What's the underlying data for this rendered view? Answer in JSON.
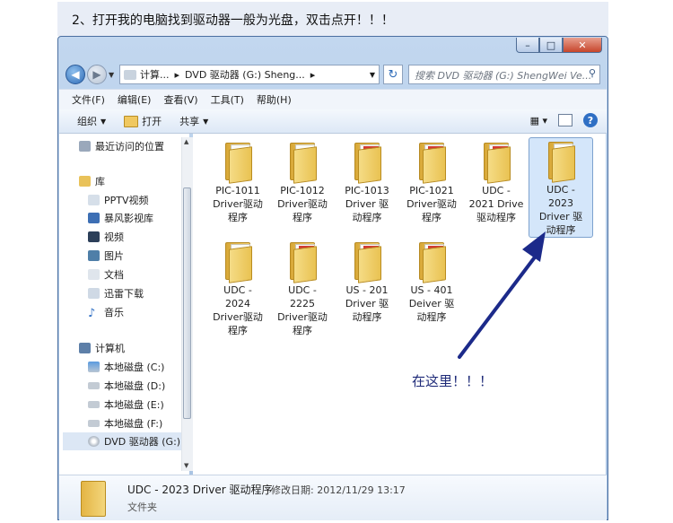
{
  "banner": {
    "text": "2、打开我的电脑找到驱动器一般为光盘，双击点开！！！"
  },
  "window": {
    "buttons": {
      "minimize": "–",
      "maximize": "□",
      "close": "✕"
    }
  },
  "address": {
    "segments": [
      "计算...",
      "▸",
      "DVD 驱动器 (G:) Sheng...",
      "▸"
    ],
    "search_placeholder": "搜索 DVD 驱动器 (G:) ShengWei Ve..."
  },
  "menu": [
    "文件(F)",
    "编辑(E)",
    "查看(V)",
    "工具(T)",
    "帮助(H)"
  ],
  "toolbar": {
    "organize": "组织",
    "open": "打开",
    "share": "共享"
  },
  "nav": {
    "recent": "最近访问的位置",
    "libraries": "库",
    "lib_items": [
      "PPTV视频",
      "暴风影视库",
      "视频",
      "图片",
      "文档",
      "迅雷下载",
      "音乐"
    ],
    "computer": "计算机",
    "drives": [
      "本地磁盘 (C:)",
      "本地磁盘 (D:)",
      "本地磁盘 (E:)",
      "本地磁盘 (F:)",
      "DVD 驱动器 (G:)"
    ]
  },
  "files": [
    {
      "l1": "PIC-1011",
      "l2": "Driver驱动",
      "l3": "程序"
    },
    {
      "l1": "PIC-1012",
      "l2": "Driver驱动",
      "l3": "程序"
    },
    {
      "l1": "PIC-1013",
      "l2": "Driver 驱",
      "l3": "动程序"
    },
    {
      "l1": "PIC-1021",
      "l2": "Driver驱动",
      "l3": "程序"
    },
    {
      "l1": "UDC -",
      "l2": "2021 Drive",
      "l3": "驱动程序"
    },
    {
      "l1": "UDC -",
      "l2": "2023",
      "l3": "Driver 驱",
      "l4": "动程序"
    },
    {
      "l1": "UDC -",
      "l2": "2024",
      "l3": "Driver驱动",
      "l4": "程序"
    },
    {
      "l1": "UDC -",
      "l2": "2225",
      "l3": "Driver驱动",
      "l4": "程序"
    },
    {
      "l1": "US - 201",
      "l2": "Driver 驱",
      "l3": "动程序"
    },
    {
      "l1": "US - 401",
      "l2": "Deiver 驱",
      "l3": "动程序"
    }
  ],
  "annotation": {
    "text": "在这里！！！"
  },
  "details": {
    "name": "UDC - 2023 Driver 驱动程序",
    "modified": "修改日期: 2012/11/29 13:17",
    "type": "文件夹"
  }
}
